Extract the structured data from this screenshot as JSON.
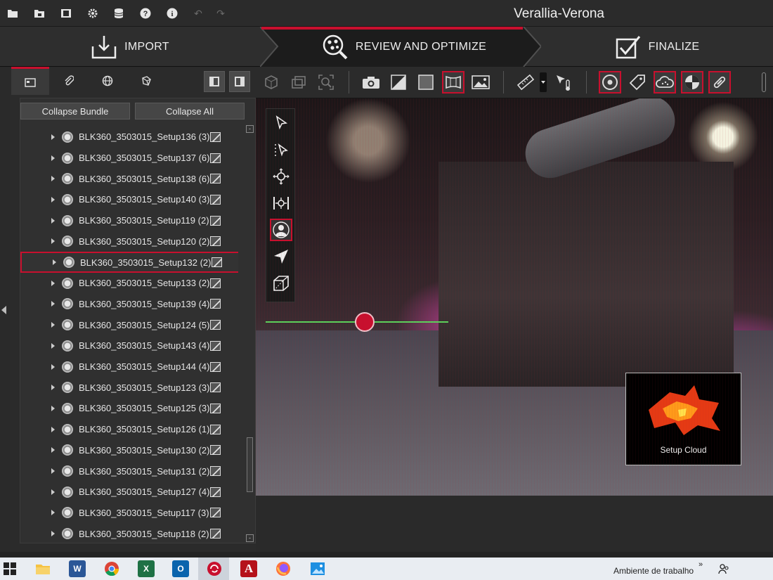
{
  "titlebar": {
    "app_title": "Verallia-Verona",
    "icons": [
      "open-folder-icon",
      "save-folder-icon",
      "export-icon",
      "gear-icon",
      "database-icon",
      "help-icon",
      "info-icon",
      "undo-icon",
      "redo-icon"
    ]
  },
  "steps": [
    {
      "label": "IMPORT",
      "icon": "import-tray-icon"
    },
    {
      "label": "REVIEW AND OPTIMIZE",
      "icon": "review-optimize-icon",
      "active": true
    },
    {
      "label": "FINALIZE",
      "icon": "checkbox-check-icon"
    }
  ],
  "left_panel": {
    "tabs": [
      "bundle-tab-icon",
      "paperclip-icon",
      "globe-icon",
      "cube-network-icon"
    ],
    "buttons": {
      "collapse_bundle": "Collapse Bundle",
      "collapse_all": "Collapse All"
    },
    "setups": [
      "BLK360_3503015_Setup136 (3)",
      "BLK360_3503015_Setup137 (6)",
      "BLK360_3503015_Setup138 (6)",
      "BLK360_3503015_Setup140 (3)",
      "BLK360_3503015_Setup119 (2)",
      "BLK360_3503015_Setup120 (2)",
      "BLK360_3503015_Setup132 (2)",
      "BLK360_3503015_Setup133 (2)",
      "BLK360_3503015_Setup139 (4)",
      "BLK360_3503015_Setup124 (5)",
      "BLK360_3503015_Setup143 (4)",
      "BLK360_3503015_Setup144 (4)",
      "BLK360_3503015_Setup123 (3)",
      "BLK360_3503015_Setup125 (3)",
      "BLK360_3503015_Setup126 (1)",
      "BLK360_3503015_Setup130 (2)",
      "BLK360_3503015_Setup131 (2)",
      "BLK360_3503015_Setup127 (4)",
      "BLK360_3503015_Setup117 (3)",
      "BLK360_3503015_Setup118 (2)"
    ],
    "selected_setup": "BLK360_3503015_Setup132 (2)",
    "scroll_collapse_symbol": "-"
  },
  "viewport": {
    "minimap_label": "Setup Cloud",
    "accent_color": "#c8102e",
    "horizon_color": "#5bd35b"
  },
  "taskbar": {
    "desktop_label": "Ambiente de trabalho",
    "chevron": "»",
    "apps": [
      "windows-start-icon",
      "file-explorer-icon",
      "word-icon",
      "chrome-icon",
      "excel-icon",
      "outlook-icon",
      "cyclone-register-icon",
      "autocad-icon",
      "firefox-icon",
      "photos-icon"
    ]
  }
}
